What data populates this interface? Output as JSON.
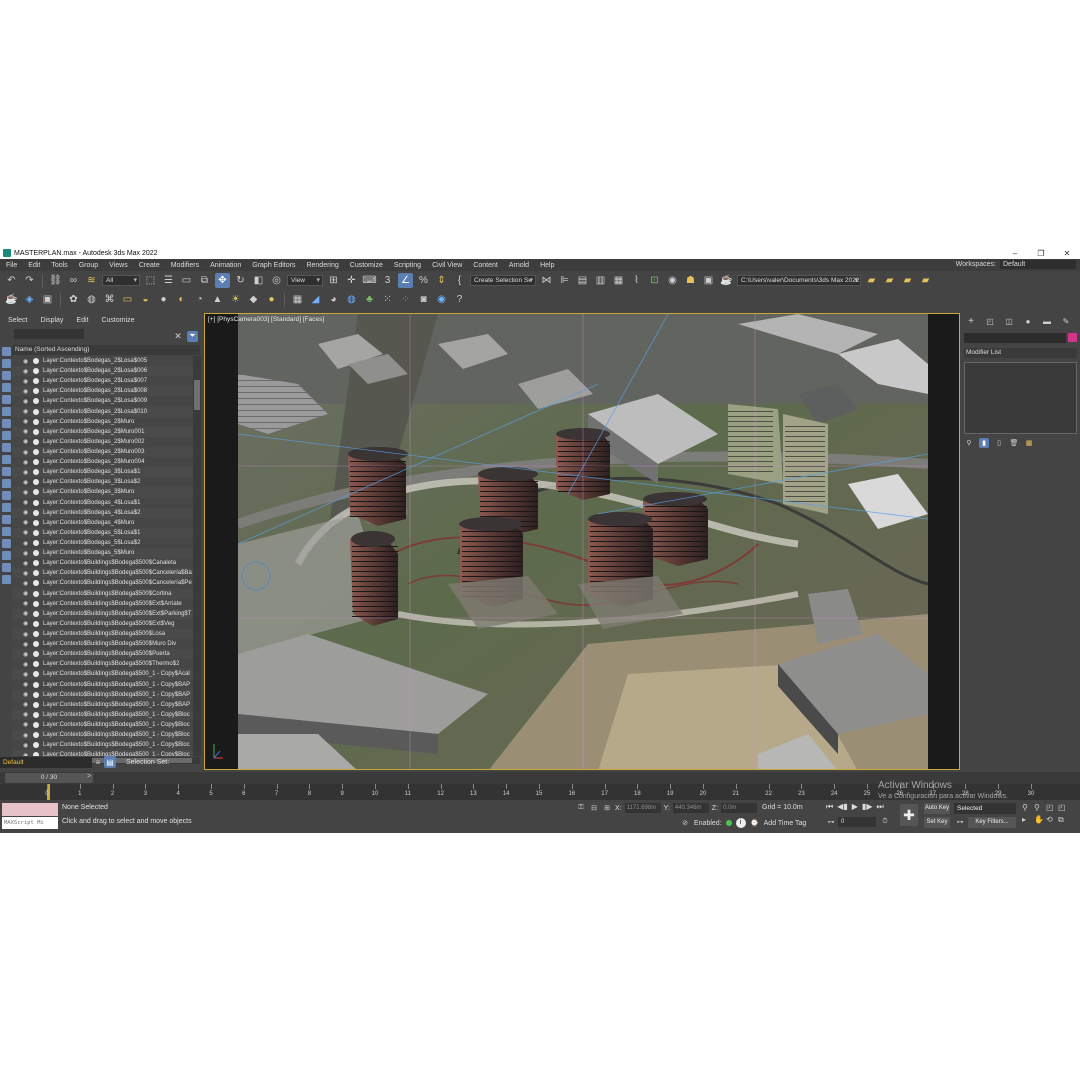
{
  "window": {
    "title": "MASTERPLAN.max - Autodesk 3ds Max 2022",
    "controls": [
      "–",
      "❐",
      "✕"
    ]
  },
  "menu": [
    "File",
    "Edit",
    "Tools",
    "Group",
    "Views",
    "Create",
    "Modifiers",
    "Animation",
    "Graph Editors",
    "Rendering",
    "Customize",
    "Scripting",
    "Civil View",
    "Content",
    "Arnold",
    "Help"
  ],
  "workspace": {
    "label": "Workspaces:",
    "value": "Default"
  },
  "toolbar": {
    "filter": "All",
    "view": "View",
    "selection_set": "Create Selection Se",
    "project_path": "C:\\Users\\valer\\Documents\\3ds Max 2022"
  },
  "explorer": {
    "menu": [
      "Select",
      "Display",
      "Edit",
      "Customize"
    ],
    "header": "Name (Sorted Ascending)",
    "rows": [
      "Layer:Contexto$Bodegas_2$Losa$005",
      "Layer:Contexto$Bodegas_2$Losa$006",
      "Layer:Contexto$Bodegas_2$Losa$007",
      "Layer:Contexto$Bodegas_2$Losa$008",
      "Layer:Contexto$Bodegas_2$Losa$009",
      "Layer:Contexto$Bodegas_2$Losa$010",
      "Layer:Contexto$Bodegas_2$Muro",
      "Layer:Contexto$Bodegas_2$Muro001",
      "Layer:Contexto$Bodegas_2$Muro002",
      "Layer:Contexto$Bodegas_2$Muro003",
      "Layer:Contexto$Bodegas_2$Muro004",
      "Layer:Contexto$Bodegas_3$Losa$1",
      "Layer:Contexto$Bodegas_3$Losa$2",
      "Layer:Contexto$Bodegas_3$Muro",
      "Layer:Contexto$Bodegas_4$Losa$1",
      "Layer:Contexto$Bodegas_4$Losa$2",
      "Layer:Contexto$Bodegas_4$Muro",
      "Layer:Contexto$Bodegas_5$Losa$1",
      "Layer:Contexto$Bodegas_5$Losa$2",
      "Layer:Contexto$Bodegas_5$Muro",
      "Layer:Contexto$Buildings$Bodega$500$Canaleta",
      "Layer:Contexto$Buildings$Bodega$500$Cancelería$Ba",
      "Layer:Contexto$Buildings$Bodega$500$Cancelería$Pe",
      "Layer:Contexto$Buildings$Bodega$500$Cortina",
      "Layer:Contexto$Buildings$Bodega$500$Ext$Arriate",
      "Layer:Contexto$Buildings$Bodega$500$Ext$Parking$T",
      "Layer:Contexto$Buildings$Bodega$500$Ext$Veg",
      "Layer:Contexto$Buildings$Bodega$500$Losa",
      "Layer:Contexto$Buildings$Bodega$500$Muro Div",
      "Layer:Contexto$Buildings$Bodega$500$Puerta",
      "Layer:Contexto$Buildings$Bodega$500$Thermo$2",
      "Layer:Contexto$Buildings$Bodega$500_1 - Copy$Acal",
      "Layer:Contexto$Buildings$Bodega$500_1 - Copy$BAP",
      "Layer:Contexto$Buildings$Bodega$500_1 - Copy$BAP",
      "Layer:Contexto$Buildings$Bodega$500_1 - Copy$BAP",
      "Layer:Contexto$Buildings$Bodega$500_1 - Copy$Bloc",
      "Layer:Contexto$Buildings$Bodega$500_1 - Copy$Bloc",
      "Layer:Contexto$Buildings$Bodega$500_1 - Copy$Bloc",
      "Layer:Contexto$Buildings$Bodega$500_1 - Copy$Bloc",
      "Layer:Contexto$Buildings$Bodega$500_1 - Copy$Bloc"
    ],
    "layer": "Default",
    "selection_set_label": "Selection Set:"
  },
  "viewport": {
    "label": "[+] [PhysCamera003] [Standard] [Faces]"
  },
  "watermark": {
    "title": "Activar Windows",
    "subtitle": "Ve a Configuración para activar Windows."
  },
  "command_panel": {
    "modifier_list": "Modifier List",
    "swatch_color": "#d3358a"
  },
  "timeline": {
    "frame_label": "0 / 30",
    "ticks": [
      "0",
      "1",
      "2",
      "3",
      "4",
      "5",
      "6",
      "7",
      "8",
      "9",
      "10",
      "11",
      "12",
      "13",
      "14",
      "15",
      "16",
      "17",
      "18",
      "19",
      "20",
      "21",
      "22",
      "23",
      "24",
      "25",
      "26",
      "27",
      "28",
      "29",
      "30"
    ]
  },
  "status": {
    "maxscript": "MAXScript Mi",
    "selection": "None Selected",
    "prompt": "Click and drag to select and move objects",
    "x_label": "X:",
    "x": "1171.698m",
    "y_label": "Y:",
    "y": "440.346m",
    "z_label": "Z:",
    "z": "0.0m",
    "grid": "Grid = 10.0m",
    "enabled": "Enabled:",
    "add_time_tag": "Add Time Tag",
    "auto_key": "Auto Key",
    "set_key": "Set Key",
    "selected": "Selected",
    "key_filters": "Key Filters...",
    "frame_value": "0"
  }
}
